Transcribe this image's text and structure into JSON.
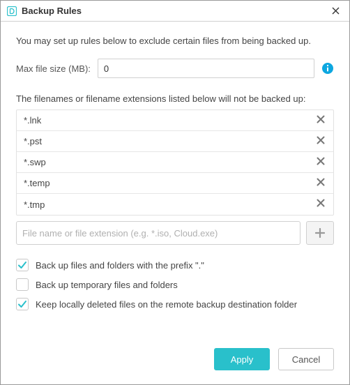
{
  "window": {
    "title": "Backup Rules"
  },
  "description": "You may set up rules below to exclude certain files from being backed up.",
  "maxSize": {
    "label": "Max file size (MB):",
    "value": "0"
  },
  "filenamesLabel": "The filenames or filename extensions listed below will not be backed up:",
  "extensions": [
    "*.lnk",
    "*.pst",
    "*.swp",
    "*.temp",
    "*.tmp"
  ],
  "addInput": {
    "placeholder": "File name or file extension (e.g. *.iso, Cloud.exe)"
  },
  "checkboxes": [
    {
      "label": "Back up files and folders with the prefix \".\"",
      "checked": true
    },
    {
      "label": "Back up temporary files and folders",
      "checked": false
    },
    {
      "label": "Keep locally deleted files on the remote backup destination folder",
      "checked": true
    }
  ],
  "buttons": {
    "apply": "Apply",
    "cancel": "Cancel"
  },
  "colors": {
    "accent": "#29c0cb"
  }
}
